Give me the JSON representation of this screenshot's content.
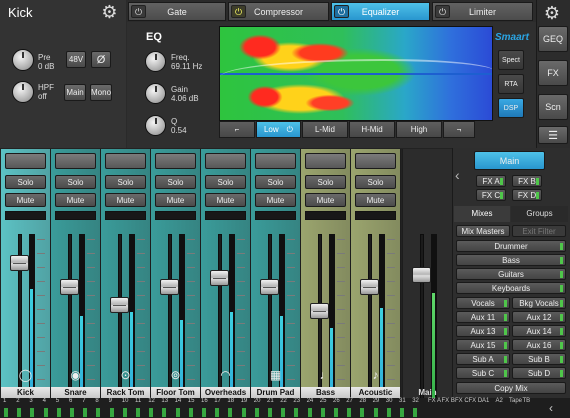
{
  "header": {
    "channel_name": "Kick"
  },
  "plugin_tabs": [
    {
      "label": "Gate",
      "active": false
    },
    {
      "label": "Compressor",
      "active": false
    },
    {
      "label": "Equalizer",
      "active": true
    },
    {
      "label": "Limiter",
      "active": false
    }
  ],
  "input": {
    "pre_label": "Pre",
    "pre_value": "0 dB",
    "hpf_label": "HPF",
    "hpf_value": "off",
    "phantom_label": "48V",
    "phase_label": "Ø",
    "main_label": "Main",
    "mono_label": "Mono"
  },
  "eq": {
    "title": "EQ",
    "freq_label": "Freq.",
    "freq_value": "69.11 Hz",
    "gain_label": "Gain",
    "gain_value": "4.06 dB",
    "q_label": "Q",
    "q_value": "0.54",
    "smaart_label": "Smaart",
    "spect_label": "Spect",
    "rta_label": "RTA",
    "dsp_label": "DSP",
    "bands": [
      "Low",
      "L-Mid",
      "H-Mid",
      "High"
    ],
    "active_band": "Low"
  },
  "right_nav": {
    "geq": "GEQ",
    "fx": "FX",
    "scn": "Scn"
  },
  "channels": [
    {
      "name": "Kick",
      "solo": "Solo",
      "mute": "Mute",
      "color": "#5cc2c4",
      "fader": 0.86,
      "meter": 0.72,
      "icon": "kick-drum-icon"
    },
    {
      "name": "Snare",
      "solo": "Solo",
      "mute": "Mute",
      "color": "#3a9c9a",
      "fader": 0.7,
      "meter": 0.58,
      "icon": "snare-drum-icon"
    },
    {
      "name": "Rack Tom",
      "solo": "Solo",
      "mute": "Mute",
      "color": "#3a9c9a",
      "fader": 0.58,
      "meter": 0.6,
      "icon": "rack-tom-icon"
    },
    {
      "name": "Floor Tom",
      "solo": "Solo",
      "mute": "Mute",
      "color": "#3a9c9a",
      "fader": 0.7,
      "meter": 0.56,
      "icon": "floor-tom-icon"
    },
    {
      "name": "Overheads",
      "solo": "Solo",
      "mute": "Mute",
      "color": "#3a9c9a",
      "fader": 0.76,
      "meter": 0.6,
      "icon": "overheads-icon"
    },
    {
      "name": "Drum Pad",
      "solo": "Solo",
      "mute": "Mute",
      "color": "#3a9c9a",
      "fader": 0.7,
      "meter": 0.58,
      "icon": "drum-pad-icon"
    },
    {
      "name": "Bass",
      "solo": "Solo",
      "mute": "Mute",
      "color": "#9ba56e",
      "fader": 0.54,
      "meter": 0.52,
      "icon": "bass-guitar-icon"
    },
    {
      "name": "Acoustic",
      "solo": "Solo",
      "mute": "Mute",
      "color": "#9ba56e",
      "fader": 0.7,
      "meter": 0.62,
      "icon": "acoustic-guitar-icon"
    }
  ],
  "main_channel": {
    "name": "Main",
    "fader": 0.78,
    "meter": 0.7
  },
  "mix_panel": {
    "main_label": "Main",
    "fx_buttons": [
      "FX A",
      "FX B",
      "FX C",
      "FX D"
    ],
    "tabs": [
      "Mixes",
      "Groups"
    ],
    "mix_masters": "Mix Masters",
    "exit_filter": "Exit Filter",
    "groups": [
      "Drummer",
      "Bass",
      "Guitars",
      "Keyboards"
    ],
    "pairs": [
      [
        "Vocals",
        "Bkg Vocals"
      ],
      [
        "Aux 11",
        "Aux 12"
      ],
      [
        "Aux 13",
        "Aux 14"
      ],
      [
        "Aux 15",
        "Aux 16"
      ],
      [
        "Sub A",
        "Sub B"
      ],
      [
        "Sub C",
        "Sub D"
      ]
    ],
    "copy_mix": "Copy Mix"
  },
  "bottom_strip": {
    "numbers": [
      "1",
      "2",
      "3",
      "4",
      "5",
      "6",
      "7",
      "8",
      "9",
      "10",
      "11",
      "12",
      "13",
      "14",
      "15",
      "16",
      "17",
      "18",
      "19",
      "20",
      "21",
      "22",
      "23",
      "24",
      "25",
      "26",
      "27",
      "28",
      "29",
      "30",
      "31",
      "32"
    ],
    "tail": [
      "FX A",
      "FX B",
      "FX C",
      "FX D",
      "A1",
      "A2",
      "Tape",
      "TB"
    ]
  }
}
